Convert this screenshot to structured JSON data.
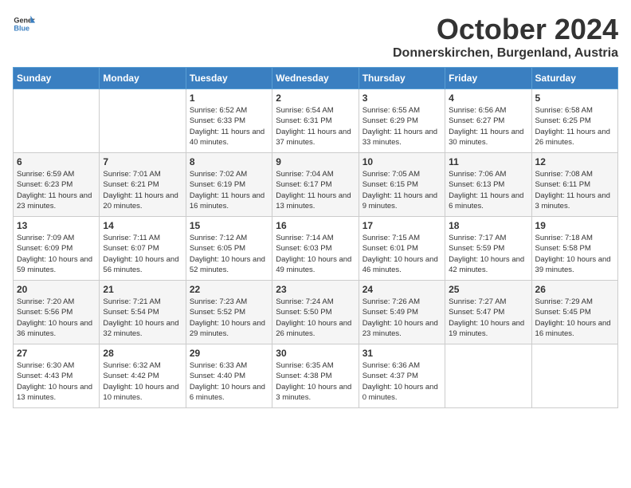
{
  "header": {
    "logo_general": "General",
    "logo_blue": "Blue",
    "month_title": "October 2024",
    "location": "Donnerskirchen, Burgenland, Austria"
  },
  "days_of_week": [
    "Sunday",
    "Monday",
    "Tuesday",
    "Wednesday",
    "Thursday",
    "Friday",
    "Saturday"
  ],
  "weeks": [
    [
      {
        "day": "",
        "info": ""
      },
      {
        "day": "",
        "info": ""
      },
      {
        "day": "1",
        "info": "Sunrise: 6:52 AM\nSunset: 6:33 PM\nDaylight: 11 hours and 40 minutes."
      },
      {
        "day": "2",
        "info": "Sunrise: 6:54 AM\nSunset: 6:31 PM\nDaylight: 11 hours and 37 minutes."
      },
      {
        "day": "3",
        "info": "Sunrise: 6:55 AM\nSunset: 6:29 PM\nDaylight: 11 hours and 33 minutes."
      },
      {
        "day": "4",
        "info": "Sunrise: 6:56 AM\nSunset: 6:27 PM\nDaylight: 11 hours and 30 minutes."
      },
      {
        "day": "5",
        "info": "Sunrise: 6:58 AM\nSunset: 6:25 PM\nDaylight: 11 hours and 26 minutes."
      }
    ],
    [
      {
        "day": "6",
        "info": "Sunrise: 6:59 AM\nSunset: 6:23 PM\nDaylight: 11 hours and 23 minutes."
      },
      {
        "day": "7",
        "info": "Sunrise: 7:01 AM\nSunset: 6:21 PM\nDaylight: 11 hours and 20 minutes."
      },
      {
        "day": "8",
        "info": "Sunrise: 7:02 AM\nSunset: 6:19 PM\nDaylight: 11 hours and 16 minutes."
      },
      {
        "day": "9",
        "info": "Sunrise: 7:04 AM\nSunset: 6:17 PM\nDaylight: 11 hours and 13 minutes."
      },
      {
        "day": "10",
        "info": "Sunrise: 7:05 AM\nSunset: 6:15 PM\nDaylight: 11 hours and 9 minutes."
      },
      {
        "day": "11",
        "info": "Sunrise: 7:06 AM\nSunset: 6:13 PM\nDaylight: 11 hours and 6 minutes."
      },
      {
        "day": "12",
        "info": "Sunrise: 7:08 AM\nSunset: 6:11 PM\nDaylight: 11 hours and 3 minutes."
      }
    ],
    [
      {
        "day": "13",
        "info": "Sunrise: 7:09 AM\nSunset: 6:09 PM\nDaylight: 10 hours and 59 minutes."
      },
      {
        "day": "14",
        "info": "Sunrise: 7:11 AM\nSunset: 6:07 PM\nDaylight: 10 hours and 56 minutes."
      },
      {
        "day": "15",
        "info": "Sunrise: 7:12 AM\nSunset: 6:05 PM\nDaylight: 10 hours and 52 minutes."
      },
      {
        "day": "16",
        "info": "Sunrise: 7:14 AM\nSunset: 6:03 PM\nDaylight: 10 hours and 49 minutes."
      },
      {
        "day": "17",
        "info": "Sunrise: 7:15 AM\nSunset: 6:01 PM\nDaylight: 10 hours and 46 minutes."
      },
      {
        "day": "18",
        "info": "Sunrise: 7:17 AM\nSunset: 5:59 PM\nDaylight: 10 hours and 42 minutes."
      },
      {
        "day": "19",
        "info": "Sunrise: 7:18 AM\nSunset: 5:58 PM\nDaylight: 10 hours and 39 minutes."
      }
    ],
    [
      {
        "day": "20",
        "info": "Sunrise: 7:20 AM\nSunset: 5:56 PM\nDaylight: 10 hours and 36 minutes."
      },
      {
        "day": "21",
        "info": "Sunrise: 7:21 AM\nSunset: 5:54 PM\nDaylight: 10 hours and 32 minutes."
      },
      {
        "day": "22",
        "info": "Sunrise: 7:23 AM\nSunset: 5:52 PM\nDaylight: 10 hours and 29 minutes."
      },
      {
        "day": "23",
        "info": "Sunrise: 7:24 AM\nSunset: 5:50 PM\nDaylight: 10 hours and 26 minutes."
      },
      {
        "day": "24",
        "info": "Sunrise: 7:26 AM\nSunset: 5:49 PM\nDaylight: 10 hours and 23 minutes."
      },
      {
        "day": "25",
        "info": "Sunrise: 7:27 AM\nSunset: 5:47 PM\nDaylight: 10 hours and 19 minutes."
      },
      {
        "day": "26",
        "info": "Sunrise: 7:29 AM\nSunset: 5:45 PM\nDaylight: 10 hours and 16 minutes."
      }
    ],
    [
      {
        "day": "27",
        "info": "Sunrise: 6:30 AM\nSunset: 4:43 PM\nDaylight: 10 hours and 13 minutes."
      },
      {
        "day": "28",
        "info": "Sunrise: 6:32 AM\nSunset: 4:42 PM\nDaylight: 10 hours and 10 minutes."
      },
      {
        "day": "29",
        "info": "Sunrise: 6:33 AM\nSunset: 4:40 PM\nDaylight: 10 hours and 6 minutes."
      },
      {
        "day": "30",
        "info": "Sunrise: 6:35 AM\nSunset: 4:38 PM\nDaylight: 10 hours and 3 minutes."
      },
      {
        "day": "31",
        "info": "Sunrise: 6:36 AM\nSunset: 4:37 PM\nDaylight: 10 hours and 0 minutes."
      },
      {
        "day": "",
        "info": ""
      },
      {
        "day": "",
        "info": ""
      }
    ]
  ]
}
